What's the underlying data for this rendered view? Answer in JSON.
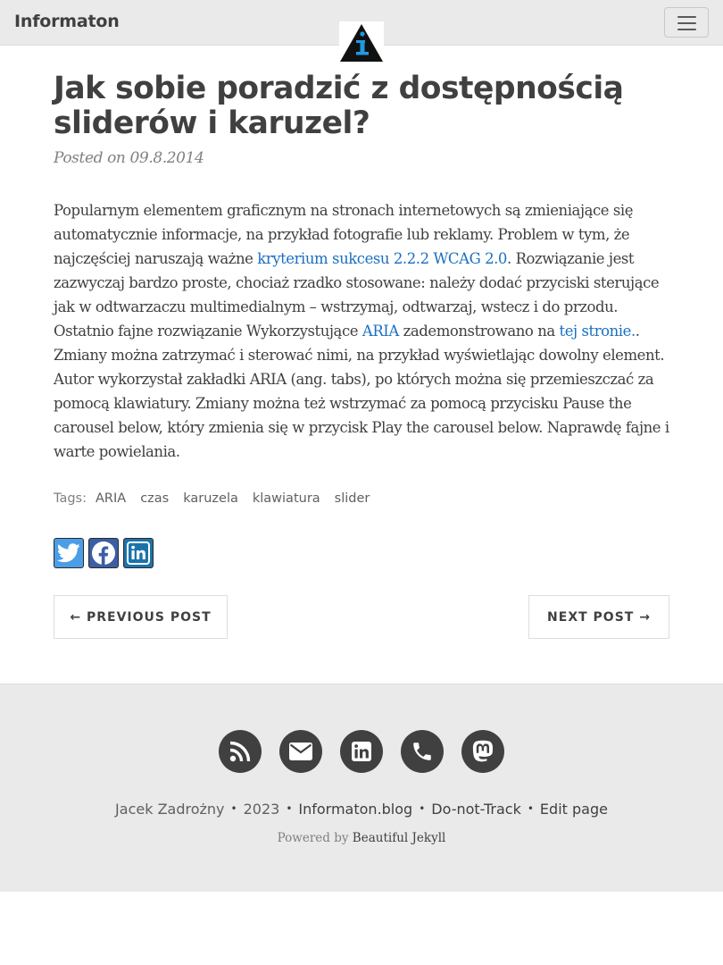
{
  "navbar": {
    "brand": "Informaton",
    "menu_icon": "hamburger-menu-icon",
    "logo_icon": "info-triangle-logo",
    "colors": {
      "background": "#eaeaea",
      "logo_blue": "#1e9be0"
    }
  },
  "post": {
    "title": "Jak sobie poradzić z dostępnością sliderów i karuzel?",
    "meta_prefix": "Posted on",
    "date": "09.8.2014",
    "body": {
      "t1": "Popularnym elementem graficznym na stronach internetowych są zmieniające się automatycznie informacje, na przykład fotografie lub reklamy. Problem w tym, że najczęściej naruszają ważne ",
      "link1": "kryterium sukcesu 2.2.2 WCAG 2.0",
      "t2": ". Rozwiązanie jest zazwyczaj bardzo proste, chociaż rzadko stosowane: należy dodać przyciski sterujące jak w odtwarzaczu multimedialnym – wstrzymaj, odtwarzaj, wstecz i do przodu. Ostatnio fajne rozwiązanie Wykorzystujące ",
      "link2": "ARIA",
      "t3": " zademonstrowano na ",
      "link3": "tej stronie.",
      "t4": ". Zmiany można zatrzymać i sterować nimi, na przykład wyświetlając dowolny element. Autor wykorzystał zakładki ARIA (ang. tabs), po których można się przemieszczać za pomocą klawiatury. Zmiany można też wstrzymać za pomocą przycisku Pause the carousel below, który zmienia się w przycisk Play the carousel below. Naprawdę fajne i warte powielania."
    },
    "link_color": "#1a6fc2"
  },
  "tags": {
    "label": "Tags:",
    "items": [
      "ARIA",
      "czas",
      "karuzela",
      "klawiatura",
      "slider"
    ]
  },
  "share": {
    "buttons": [
      {
        "icon": "twitter-icon",
        "color": "#4b9ee6"
      },
      {
        "icon": "facebook-icon",
        "color": "#3b5ea5"
      },
      {
        "icon": "linkedin-icon",
        "color": "#1c73aa"
      }
    ]
  },
  "pager": {
    "prev": "← PREVIOUS POST",
    "next": "NEXT POST →"
  },
  "footer": {
    "social_icons": [
      "rss-icon",
      "envelope-icon",
      "linkedin-icon",
      "phone-icon",
      "mastodon-icon"
    ],
    "author": "Jacek Zadrożny",
    "year": "2023",
    "site": "Informaton.blog",
    "dnt": "Do-not-Track",
    "edit": "Edit page",
    "powered_prefix": "Powered by",
    "powered_link": "Beautiful Jekyll",
    "colors": {
      "background": "#eaeaea",
      "icon_circle": "#404040"
    }
  }
}
